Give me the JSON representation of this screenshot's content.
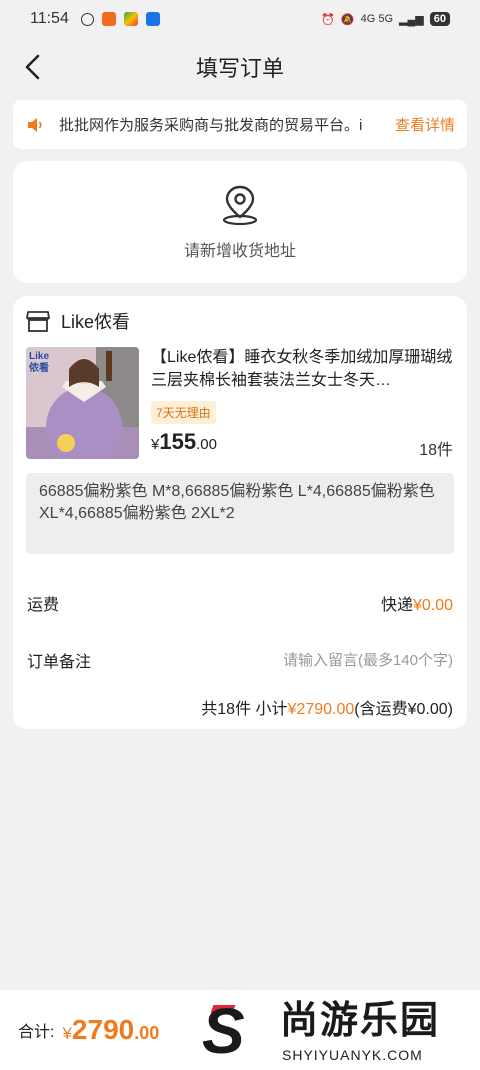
{
  "status_bar": {
    "time": "11:54",
    "network": "4G 5G",
    "battery": "60",
    "app_icons": [
      "K-icon",
      "app-orange-icon",
      "play-icon",
      "zhihu-icon"
    ]
  },
  "nav": {
    "title": "填写订单"
  },
  "notice": {
    "text": "批批网作为服务采购商与批发商的贸易平台。i",
    "link": "查看详情"
  },
  "address": {
    "label": "请新增收货地址"
  },
  "shop": {
    "name": "Like侬看"
  },
  "product": {
    "thumb_tag": "Like\n侬看",
    "title": "【Like侬看】睡衣女秋冬季加绒加厚珊瑚绒三层夹棉长袖套装法兰女士冬天…",
    "return_tag": "7天无理由",
    "price_symbol": "¥",
    "price_int": "155",
    "price_dec": ".00",
    "quantity": "18件",
    "specs": "66885偏粉紫色 M*8,66885偏粉紫色 L*4,66885偏粉紫色 XL*4,66885偏粉紫色 2XL*2"
  },
  "shipping": {
    "label": "运费",
    "method": "快递",
    "fee": "¥0.00"
  },
  "remark": {
    "label": "订单备注",
    "placeholder": "请输入留言(最多140个字)"
  },
  "summary": {
    "count": "共18件",
    "subtotal_label": "小计",
    "subtotal": "¥2790.00",
    "shipping_note": "(含运费¥0.00)"
  },
  "footer": {
    "total_label": "合计:",
    "total_symbol": "¥",
    "total_int": "2790",
    "total_dec": ".00"
  },
  "watermark": {
    "letter": "S",
    "title": "尚游乐园",
    "url": "SHYIYUANYK.COM"
  },
  "colors": {
    "accent": "#f07b1e",
    "background": "#f1f1f1",
    "card": "#ffffff"
  }
}
